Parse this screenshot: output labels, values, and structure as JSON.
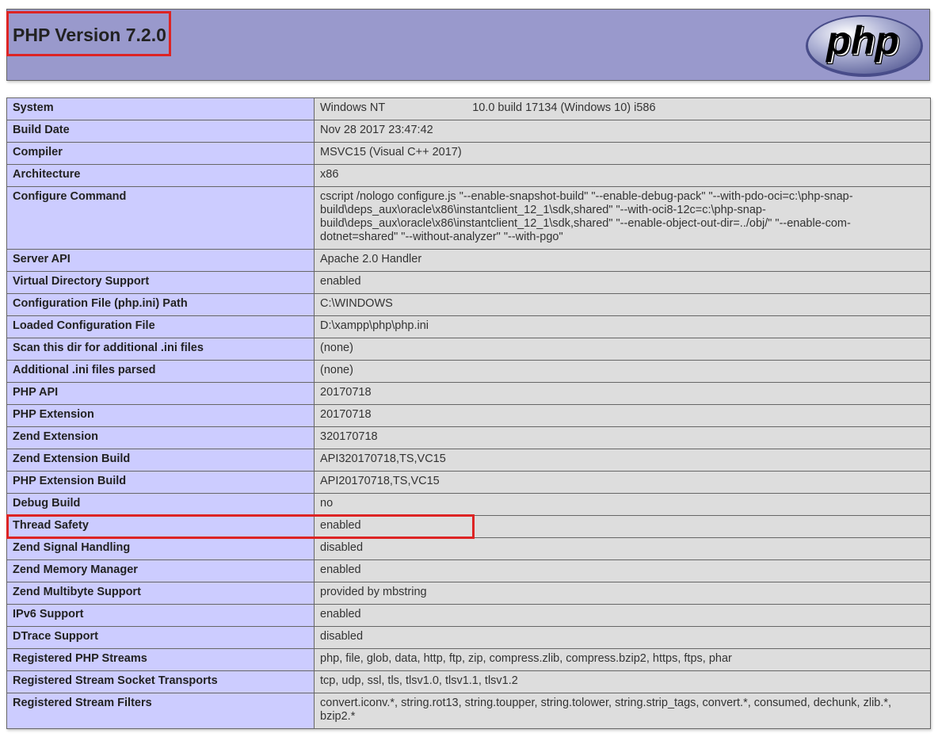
{
  "header": {
    "title": "PHP Version 7.2.0",
    "logo_text": "php"
  },
  "colors": {
    "header_bg": "#9999cc",
    "label_bg": "#ccccff",
    "value_bg": "#dddddd",
    "highlight": "#dd2424"
  },
  "rows": [
    {
      "label": "System",
      "value": "Windows NT",
      "value2": "10.0 build 17134 (Windows 10) i586"
    },
    {
      "label": "Build Date",
      "value": "Nov 28 2017 23:47:42"
    },
    {
      "label": "Compiler",
      "value": "MSVC15 (Visual C++ 2017)"
    },
    {
      "label": "Architecture",
      "value": "x86"
    },
    {
      "label": "Configure Command",
      "value": "cscript /nologo configure.js \"--enable-snapshot-build\" \"--enable-debug-pack\" \"--with-pdo-oci=c:\\php-snap-build\\deps_aux\\oracle\\x86\\instantclient_12_1\\sdk,shared\" \"--with-oci8-12c=c:\\php-snap-build\\deps_aux\\oracle\\x86\\instantclient_12_1\\sdk,shared\" \"--enable-object-out-dir=../obj/\" \"--enable-com-dotnet=shared\" \"--without-analyzer\" \"--with-pgo\""
    },
    {
      "label": "Server API",
      "value": "Apache 2.0 Handler"
    },
    {
      "label": "Virtual Directory Support",
      "value": "enabled"
    },
    {
      "label": "Configuration File (php.ini) Path",
      "value": "C:\\WINDOWS"
    },
    {
      "label": "Loaded Configuration File",
      "value": "D:\\xampp\\php\\php.ini"
    },
    {
      "label": "Scan this dir for additional .ini files",
      "value": "(none)"
    },
    {
      "label": "Additional .ini files parsed",
      "value": "(none)"
    },
    {
      "label": "PHP API",
      "value": "20170718"
    },
    {
      "label": "PHP Extension",
      "value": "20170718"
    },
    {
      "label": "Zend Extension",
      "value": "320170718"
    },
    {
      "label": "Zend Extension Build",
      "value": "API320170718,TS,VC15"
    },
    {
      "label": "PHP Extension Build",
      "value": "API20170718,TS,VC15"
    },
    {
      "label": "Debug Build",
      "value": "no"
    },
    {
      "label": "Thread Safety",
      "value": "enabled"
    },
    {
      "label": "Zend Signal Handling",
      "value": "disabled"
    },
    {
      "label": "Zend Memory Manager",
      "value": "enabled"
    },
    {
      "label": "Zend Multibyte Support",
      "value": "provided by mbstring"
    },
    {
      "label": "IPv6 Support",
      "value": "enabled"
    },
    {
      "label": "DTrace Support",
      "value": "disabled"
    },
    {
      "label": "Registered PHP Streams",
      "value": "php, file, glob, data, http, ftp, zip, compress.zlib, compress.bzip2, https, ftps, phar"
    },
    {
      "label": "Registered Stream Socket Transports",
      "value": "tcp, udp, ssl, tls, tlsv1.0, tlsv1.1, tlsv1.2"
    },
    {
      "label": "Registered Stream Filters",
      "value": "convert.iconv.*, string.rot13, string.toupper, string.tolower, string.strip_tags, convert.*, consumed, dechunk, zlib.*, bzip2.*"
    }
  ]
}
